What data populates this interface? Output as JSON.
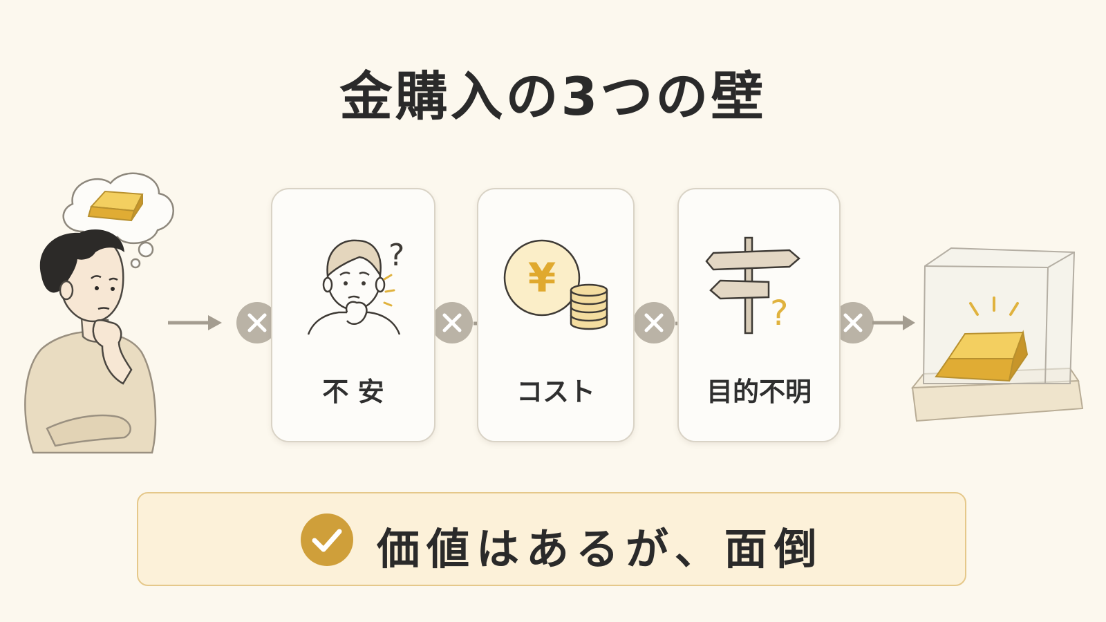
{
  "title": "金購入の3つの壁",
  "barriers": [
    {
      "label": "不 安",
      "icon": "worried-person-icon"
    },
    {
      "label": "コスト",
      "icon": "yen-coins-icon"
    },
    {
      "label": "目的不明",
      "icon": "signpost-question-icon"
    }
  ],
  "banner": {
    "text": "価値はあるが、面倒",
    "icon": "check-circle-icon"
  },
  "colors": {
    "background": "#fcf8ee",
    "gold": "#e0b23e",
    "check": "#cf9f3a",
    "x_badge": "#bab3a6",
    "banner_fill": "#fcf1d9",
    "banner_border": "#e5c88a",
    "sweater": "#e9dcc1"
  },
  "illustrations": {
    "left": "thinking-person-with-gold-bar-thought",
    "right": "gold-bar-in-glass-display-case"
  }
}
